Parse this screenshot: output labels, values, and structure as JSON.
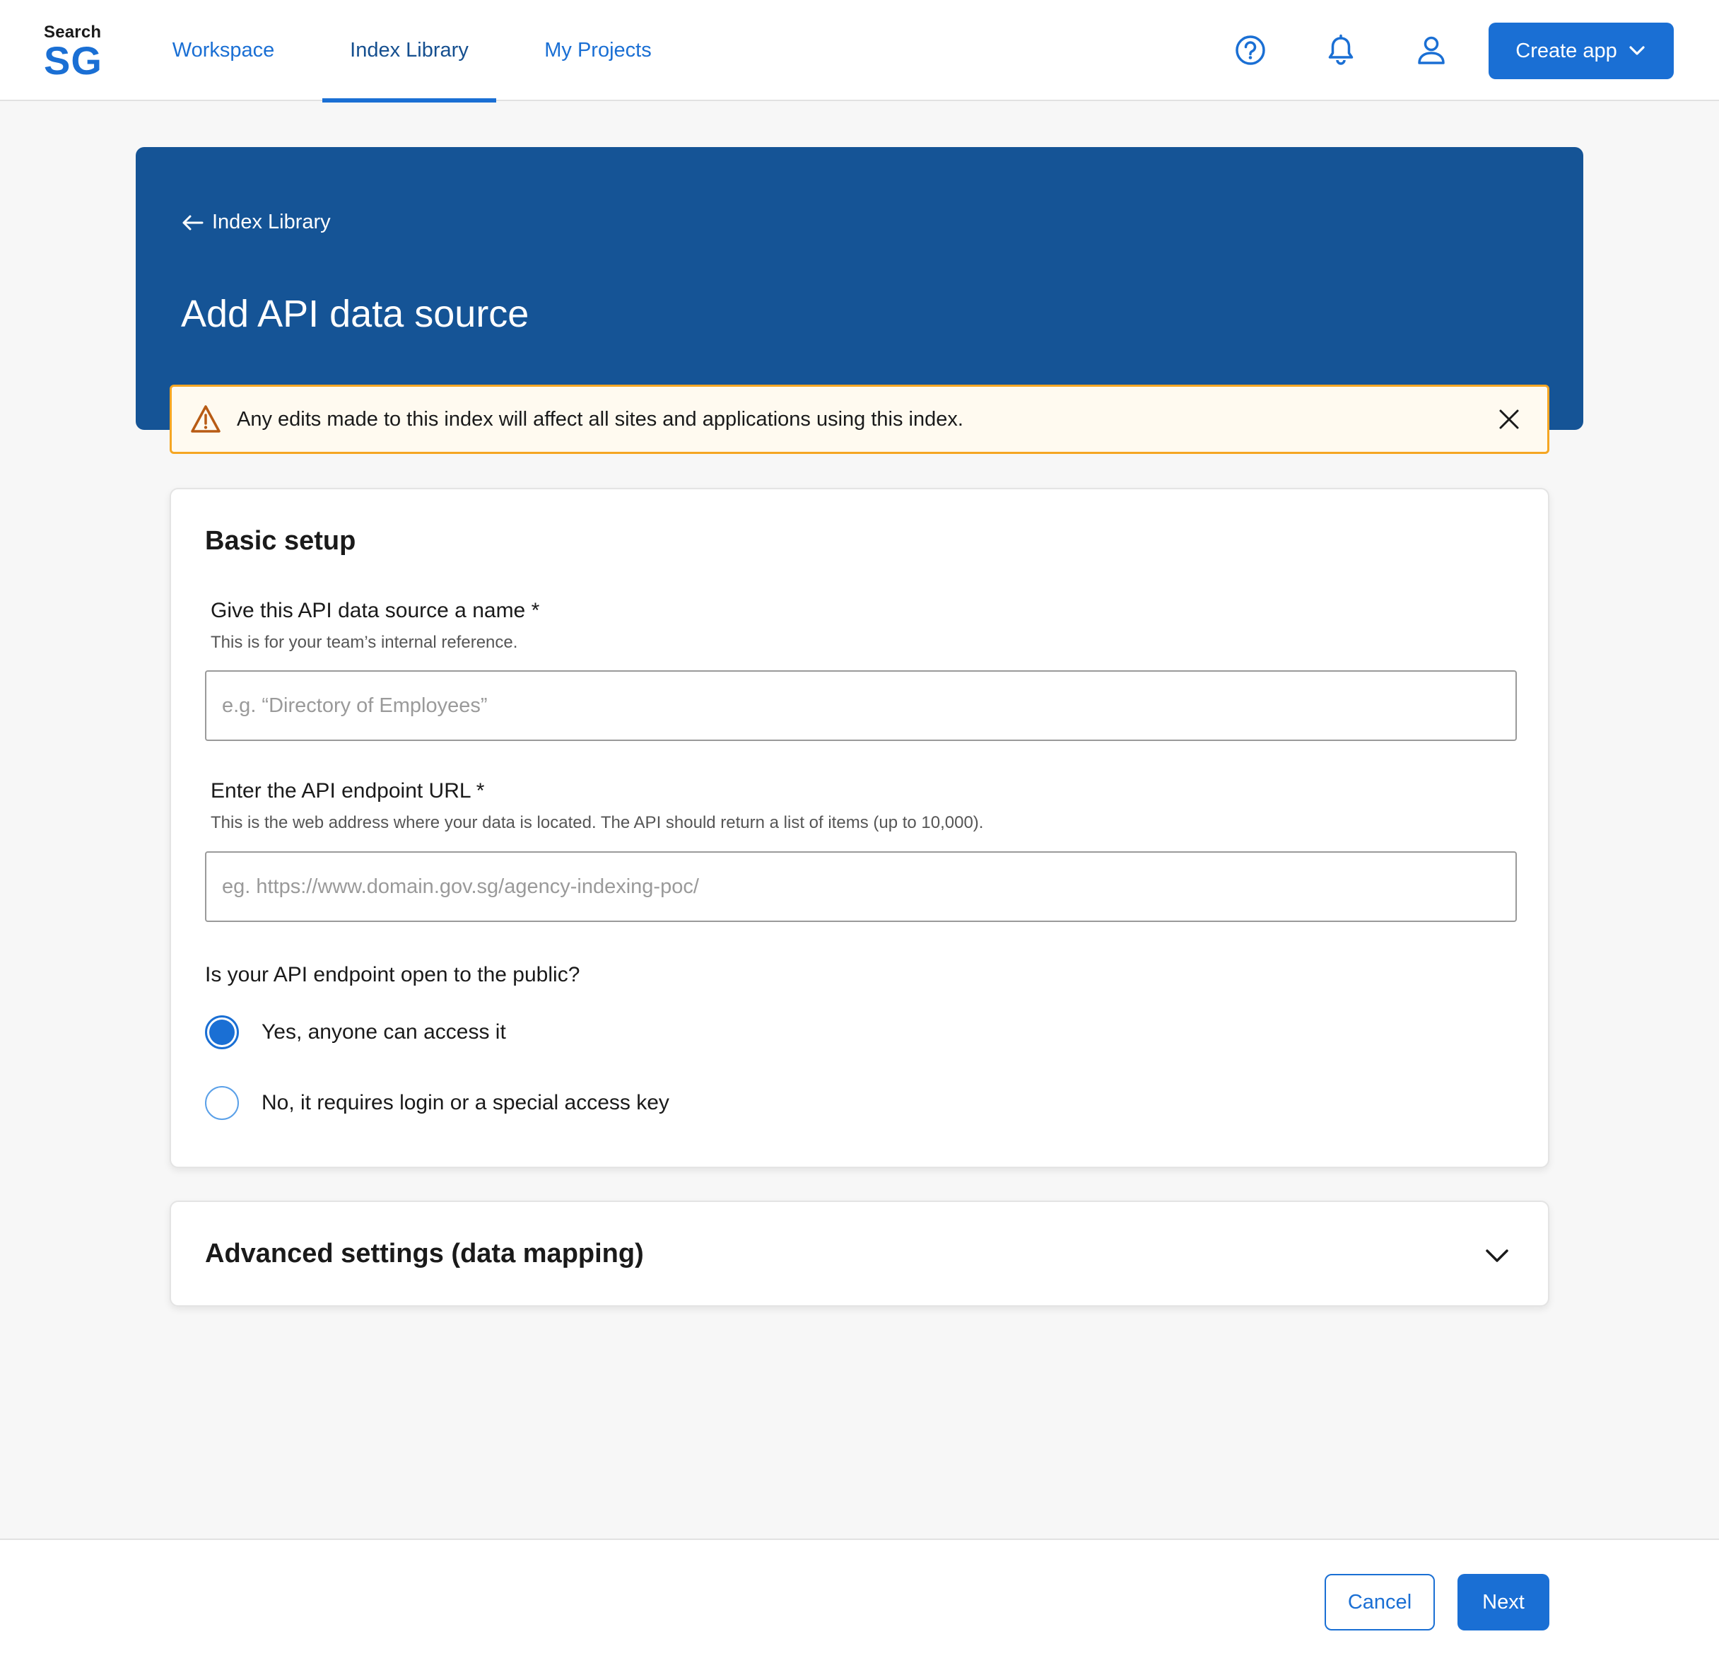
{
  "header": {
    "logo_small": "Search",
    "logo_big": "SG",
    "nav": [
      {
        "label": "Workspace",
        "active": false
      },
      {
        "label": "Index Library",
        "active": true
      },
      {
        "label": "My Projects",
        "active": false
      }
    ],
    "icons": [
      "help-icon",
      "bell-icon",
      "user-icon"
    ],
    "create_button": "Create app"
  },
  "hero": {
    "back_label": "Index Library",
    "title": "Add API data source"
  },
  "warning": {
    "text": "Any edits made to this index will affect all sites and applications using this index."
  },
  "basic_setup": {
    "title": "Basic setup",
    "name_field": {
      "label": "Give this API data source a name *",
      "help": "This is for your team’s internal reference.",
      "placeholder": "e.g. “Directory of Employees”",
      "value": ""
    },
    "url_field": {
      "label": "Enter the API endpoint URL *",
      "help": "This is the web address where your data is located. The API should return a list of items (up to 10,000).",
      "placeholder": "eg. https://www.domain.gov.sg/agency-indexing-poc/",
      "value": ""
    },
    "access_question": "Is your API endpoint open to the public?",
    "access_options": [
      {
        "label": "Yes, anyone can access it",
        "selected": true
      },
      {
        "label": "No, it requires login or a special access key",
        "selected": false
      }
    ]
  },
  "advanced": {
    "title": "Advanced settings (data mapping)",
    "expanded": false
  },
  "footer": {
    "cancel_label": "Cancel",
    "next_label": "Next"
  },
  "colors": {
    "primary": "#1a6fd4",
    "hero_bg": "#155496",
    "warning_border": "#f5a623",
    "warning_bg": "#fffaf0",
    "page_bg": "#f7f7f7"
  }
}
